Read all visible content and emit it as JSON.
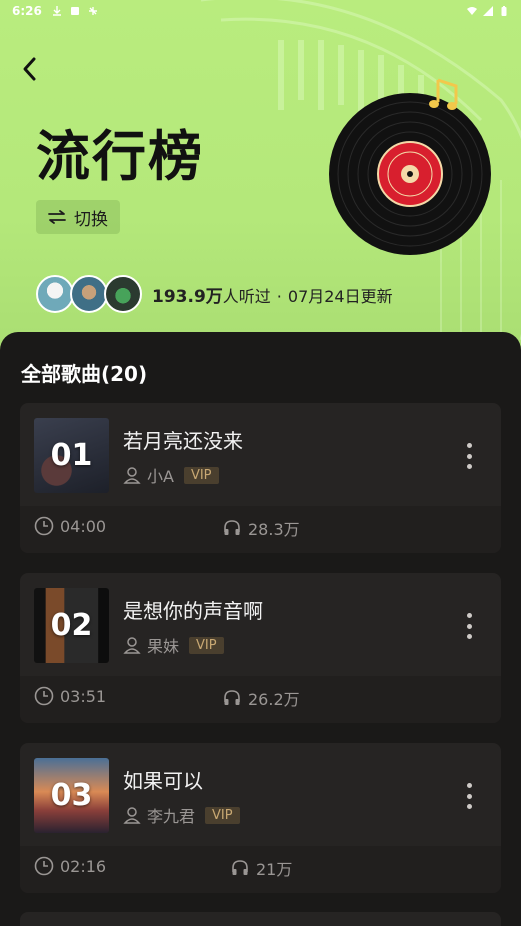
{
  "status_bar": {
    "time": "6:26"
  },
  "header": {
    "title": "流行榜",
    "switch_label": "切换"
  },
  "listeners": {
    "count": "193.9万",
    "count_suffix": "人听过",
    "separator": "·",
    "updated": "07月24日更新"
  },
  "section": {
    "title": "全部歌曲(20)"
  },
  "songs": [
    {
      "rank": "01",
      "title": "若月亮还没来",
      "artist": "小A",
      "badge": "VIP",
      "duration": "04:00",
      "plays": "28.3万"
    },
    {
      "rank": "02",
      "title": "是想你的声音啊",
      "artist": "果妹",
      "badge": "VIP",
      "duration": "03:51",
      "plays": "26.2万"
    },
    {
      "rank": "03",
      "title": "如果可以",
      "artist": "李九君",
      "badge": "VIP",
      "duration": "02:16",
      "plays": "21万"
    }
  ],
  "colors": {
    "accent": "#b9ec7e",
    "panel": "#1a1918",
    "card": "#262423",
    "vip": "#c8a873"
  }
}
